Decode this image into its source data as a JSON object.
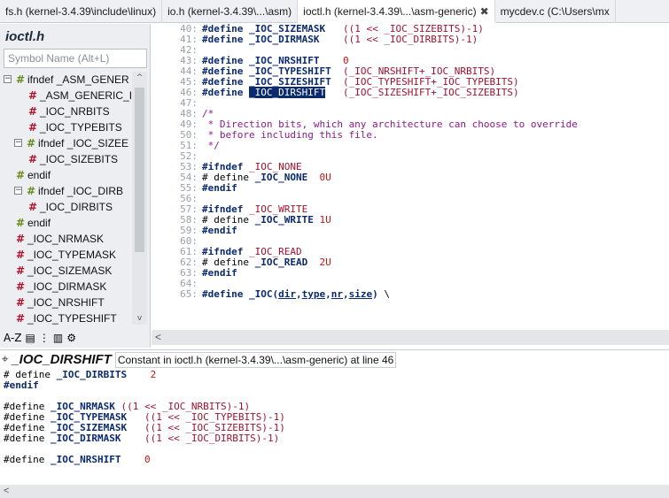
{
  "tabs": [
    {
      "label": "fs.h (kernel-3.4.39\\include\\linux)",
      "active": false
    },
    {
      "label": "io.h (kernel-3.4.39\\...\\asm)",
      "active": false
    },
    {
      "label": "ioctl.h (kernel-3.4.39\\...\\asm-generic)",
      "active": true,
      "close": "✖"
    },
    {
      "label": "mycdev.c (C:\\Users\\mx",
      "active": false
    }
  ],
  "sidebar": {
    "file_title": "ioctl.h",
    "search_placeholder": "Symbol Name (Alt+L)",
    "tree": [
      {
        "label": "ifndef _ASM_GENER",
        "icon": "ifdef-icon",
        "toggle": "−",
        "indent": 0
      },
      {
        "label": "_ASM_GENERIC_I",
        "icon": "define-icon",
        "indent": 2
      },
      {
        "label": "_IOC_NRBITS",
        "icon": "define-icon",
        "indent": 2
      },
      {
        "label": "_IOC_TYPEBITS",
        "icon": "define-icon",
        "indent": 2
      },
      {
        "label": "ifndef _IOC_SIZEE",
        "icon": "ifdef-icon",
        "toggle": "−",
        "indent": 1
      },
      {
        "label": "_IOC_SIZEBITS",
        "icon": "define-icon",
        "indent": 2
      },
      {
        "label": "endif",
        "icon": "ifdef-icon",
        "indent": 1
      },
      {
        "label": "ifndef _IOC_DIRB",
        "icon": "ifdef-icon",
        "toggle": "−",
        "indent": 1
      },
      {
        "label": "_IOC_DIRBITS",
        "icon": "define-icon",
        "indent": 2
      },
      {
        "label": "endif",
        "icon": "ifdef-icon",
        "indent": 1
      },
      {
        "label": "_IOC_NRMASK",
        "icon": "define-icon",
        "indent": 1
      },
      {
        "label": "_IOC_TYPEMASK",
        "icon": "define-icon",
        "indent": 1
      },
      {
        "label": "_IOC_SIZEMASK",
        "icon": "define-icon",
        "indent": 1
      },
      {
        "label": "_IOC_DIRMASK",
        "icon": "define-icon",
        "indent": 1
      },
      {
        "label": "_IOC_NRSHIFT",
        "icon": "define-icon",
        "indent": 1
      },
      {
        "label": "_IOC_TYPESHIFT",
        "icon": "define-icon",
        "indent": 1
      },
      {
        "label": "_IOC_SIZESHIFT",
        "icon": "define-icon",
        "indent": 1
      },
      {
        "label": "_IOC_DIRSHIFT",
        "icon": "define-icon",
        "indent": 1,
        "selected": true
      }
    ],
    "bottom_icons": [
      "sort-az-icon",
      "list-icon",
      "symbols-icon",
      "book-icon",
      "settings-gear-icon"
    ],
    "bottom_icon_glyphs": [
      "A-Z",
      "▤",
      "⋮",
      "▥",
      "⚙"
    ]
  },
  "code": [
    {
      "n": "40:",
      "parts": [
        [
          "kw",
          "#define "
        ],
        [
          "ident",
          "_IOC_SIZEMASK"
        ],
        [
          "",
          "   "
        ],
        [
          "expr",
          "((1 << _IOC_SIZEBITS)-1)"
        ]
      ]
    },
    {
      "n": "41:",
      "parts": [
        [
          "kw",
          "#define "
        ],
        [
          "ident",
          "_IOC_DIRMASK"
        ],
        [
          "",
          "    "
        ],
        [
          "expr",
          "((1 << _IOC_DIRBITS)-1)"
        ]
      ]
    },
    {
      "n": "42:",
      "parts": []
    },
    {
      "n": "43:",
      "parts": [
        [
          "kw",
          "#define "
        ],
        [
          "ident",
          "_IOC_NRSHIFT"
        ],
        [
          "",
          "    "
        ],
        [
          "num",
          "0"
        ]
      ]
    },
    {
      "n": "44:",
      "parts": [
        [
          "kw",
          "#define "
        ],
        [
          "ident",
          "_IOC_TYPESHIFT"
        ],
        [
          "",
          "  "
        ],
        [
          "expr",
          "(_IOC_NRSHIFT+_IOC_NRBITS)"
        ]
      ]
    },
    {
      "n": "45:",
      "parts": [
        [
          "kw",
          "#define "
        ],
        [
          "ident",
          "_IOC_SIZESHIFT"
        ],
        [
          "",
          "  "
        ],
        [
          "expr",
          "(_IOC_TYPESHIFT+_IOC_TYPEBITS)"
        ]
      ]
    },
    {
      "n": "46:",
      "parts": [
        [
          "kw",
          "#define "
        ],
        [
          "hl",
          "_IOC_DIRSHIFT"
        ],
        [
          "",
          "   "
        ],
        [
          "expr",
          "(_IOC_SIZESHIFT+_IOC_SIZEBITS)"
        ]
      ]
    },
    {
      "n": "47:",
      "parts": []
    },
    {
      "n": "48:",
      "parts": [
        [
          "cm",
          "/*"
        ]
      ]
    },
    {
      "n": "49:",
      "parts": [
        [
          "cm",
          " * Direction bits, which any architecture can choose to override"
        ]
      ]
    },
    {
      "n": "50:",
      "parts": [
        [
          "cm",
          " * before including this file."
        ]
      ]
    },
    {
      "n": "51:",
      "parts": [
        [
          "cm",
          " */"
        ]
      ]
    },
    {
      "n": "52:",
      "parts": []
    },
    {
      "n": "53:",
      "parts": [
        [
          "kw",
          "#ifndef "
        ],
        [
          "expr",
          "_IOC_NONE"
        ]
      ]
    },
    {
      "n": "54:",
      "parts": [
        [
          "",
          "# define "
        ],
        [
          "ident",
          "_IOC_NONE"
        ],
        [
          "",
          "  "
        ],
        [
          "num",
          "0U"
        ]
      ]
    },
    {
      "n": "55:",
      "parts": [
        [
          "kw",
          "#endif"
        ]
      ]
    },
    {
      "n": "56:",
      "parts": []
    },
    {
      "n": "57:",
      "parts": [
        [
          "kw",
          "#ifndef "
        ],
        [
          "expr",
          "_IOC_WRITE"
        ]
      ]
    },
    {
      "n": "58:",
      "parts": [
        [
          "",
          "# define "
        ],
        [
          "ident",
          "_IOC_WRITE"
        ],
        [
          "",
          ""
        ],
        [
          "num",
          " 1U"
        ]
      ]
    },
    {
      "n": "59:",
      "parts": [
        [
          "kw",
          "#endif"
        ]
      ]
    },
    {
      "n": "60:",
      "parts": []
    },
    {
      "n": "61:",
      "parts": [
        [
          "kw",
          "#ifndef "
        ],
        [
          "expr",
          "_IOC_READ"
        ]
      ]
    },
    {
      "n": "62:",
      "parts": [
        [
          "",
          "# define "
        ],
        [
          "ident",
          "_IOC_READ"
        ],
        [
          "",
          "  "
        ],
        [
          "num",
          "2U"
        ]
      ]
    },
    {
      "n": "63:",
      "parts": [
        [
          "kw",
          "#endif"
        ]
      ]
    },
    {
      "n": "64:",
      "parts": []
    },
    {
      "n": "65:",
      "parts": [
        [
          "kw",
          "#define "
        ],
        [
          "ident",
          "_IOC("
        ],
        [
          "und",
          "dir"
        ],
        [
          "ident",
          ","
        ],
        [
          "und",
          "type"
        ],
        [
          "ident",
          ","
        ],
        [
          "und",
          "nr"
        ],
        [
          "ident",
          ","
        ],
        [
          "und",
          "size"
        ],
        [
          "ident",
          ")"
        ],
        [
          "",
          " \\"
        ]
      ]
    }
  ],
  "infobar": {
    "pin_icon": "pin-icon",
    "symbol": "_IOC_DIRSHIFT",
    "description": "Constant in ioctl.h (kernel-3.4.39\\...\\asm-generic) at line 46"
  },
  "preview": [
    [
      [
        "",
        "# define "
      ],
      [
        "ident",
        "_IOC_DIRBITS"
      ],
      [
        "",
        "    "
      ],
      [
        "num",
        "2"
      ]
    ],
    [
      [
        "kw",
        "#endif"
      ]
    ],
    [],
    [
      [
        "",
        "#define "
      ],
      [
        "ident",
        "_IOC_NRMASK"
      ],
      [
        "",
        ""
      ],
      [
        "expr",
        " ((1 << _IOC_NRBITS)-1)"
      ]
    ],
    [
      [
        "",
        "#define "
      ],
      [
        "ident",
        "_IOC_TYPEMASK"
      ],
      [
        "",
        "   "
      ],
      [
        "expr",
        "((1 << _IOC_TYPEBITS)-1)"
      ]
    ],
    [
      [
        "",
        "#define "
      ],
      [
        "ident",
        "_IOC_SIZEMASK"
      ],
      [
        "",
        "   "
      ],
      [
        "expr",
        "((1 << _IOC_SIZEBITS)-1)"
      ]
    ],
    [
      [
        "",
        "#define "
      ],
      [
        "ident",
        "_IOC_DIRMASK"
      ],
      [
        "",
        "    "
      ],
      [
        "expr",
        "((1 << _IOC_DIRBITS)-1)"
      ]
    ],
    [],
    [
      [
        "",
        "#define "
      ],
      [
        "ident",
        "_IOC_NRSHIFT"
      ],
      [
        "",
        "    "
      ],
      [
        "num",
        "0"
      ]
    ]
  ],
  "scroll": {
    "left_arrow": "<",
    "up_arrow": "^",
    "down_arrow": "v"
  }
}
